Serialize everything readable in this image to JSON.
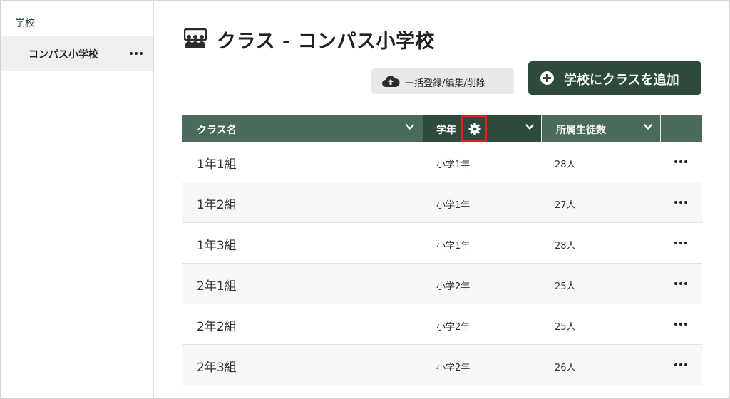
{
  "sidebar": {
    "heading": "学校",
    "items": [
      {
        "label": "コンパス小学校"
      }
    ]
  },
  "header": {
    "title": "クラス - コンパス小学校",
    "title_icon": "classroom-icon"
  },
  "toolbar": {
    "bulk_label": "一括登録/編集/削除",
    "bulk_icon": "cloud-upload-icon",
    "add_label": "学校にクラスを追加",
    "add_icon": "plus-circle-icon"
  },
  "table": {
    "columns": [
      {
        "label": "クラス名"
      },
      {
        "label": "学年"
      },
      {
        "label": "所属生徒数"
      }
    ],
    "rows": [
      {
        "name": "1年1組",
        "grade": "小学1年",
        "count": "28人"
      },
      {
        "name": "1年2組",
        "grade": "小学1年",
        "count": "27人"
      },
      {
        "name": "1年3組",
        "grade": "小学1年",
        "count": "28人"
      },
      {
        "name": "2年1組",
        "grade": "小学2年",
        "count": "25人"
      },
      {
        "name": "2年2組",
        "grade": "小学2年",
        "count": "25人"
      },
      {
        "name": "2年3組",
        "grade": "小学2年",
        "count": "26人"
      }
    ]
  },
  "colors": {
    "brand_dark": "#2d4a3d",
    "header_bg": "#4a6b5b",
    "highlight": "#e0211f"
  }
}
